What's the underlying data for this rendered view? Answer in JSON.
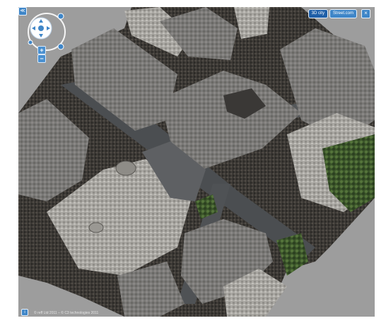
{
  "viewer": {
    "mode_tabs": [
      {
        "label": "3D city",
        "active": true
      },
      {
        "label": "Street.com",
        "active": false
      }
    ],
    "close_symbol": "×",
    "zoom_in_symbol": "+",
    "zoom_out_symbol": "−",
    "copyright": "© reff Ltd 2011 – © C3 technologies 2011"
  },
  "icons": [
    "collapse-icon",
    "navigation-ring-icon",
    "pan-arrows-icon",
    "rotate-left-icon",
    "rotate-right-icon",
    "zoom-in-icon",
    "zoom-out-icon",
    "close-icon",
    "info-icon"
  ],
  "colors": {
    "background": "#9d9d9d",
    "control_blue": "#3f86c8",
    "control_blue_active": "#1f5fa8",
    "roof": "#7b7b79",
    "road": "#4c4f52",
    "vegetation": "#3f5a2c"
  }
}
